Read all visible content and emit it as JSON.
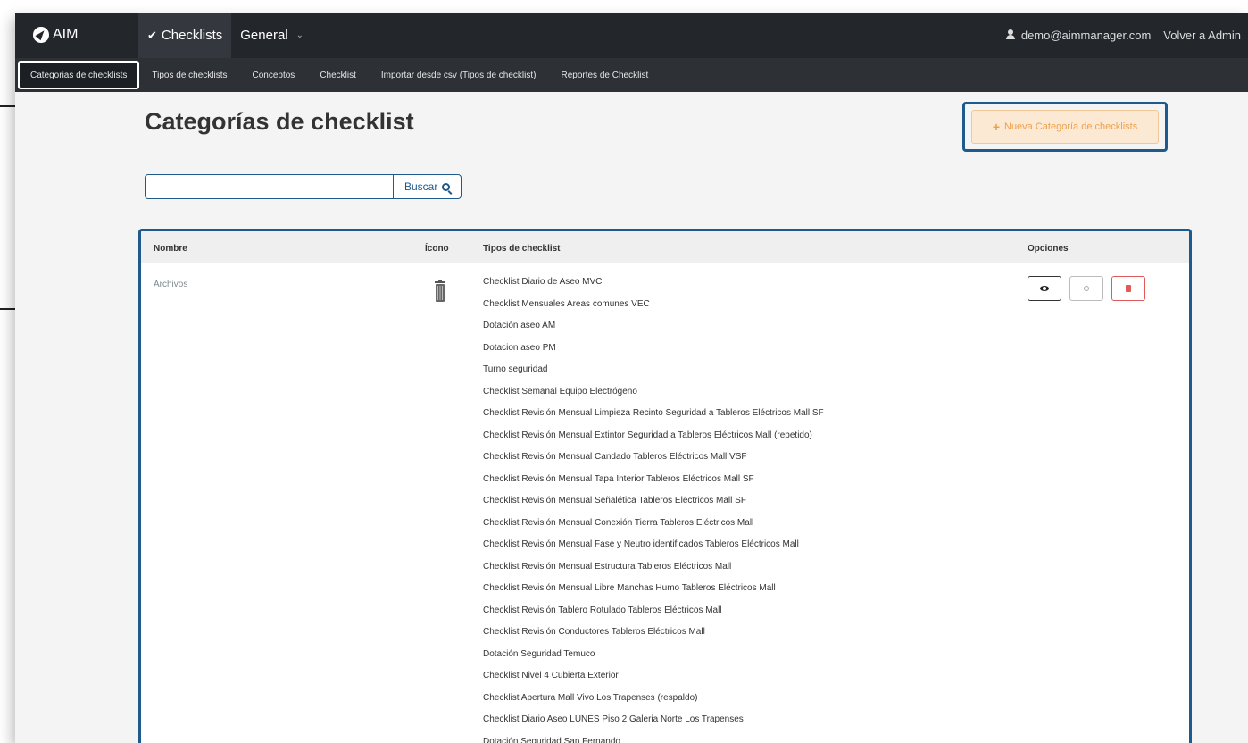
{
  "brand": {
    "name": "AIM"
  },
  "topnav": {
    "tabs": [
      {
        "label": "Checklists",
        "active": true
      },
      {
        "label": "General",
        "dropdown": true
      }
    ],
    "user_email": "demo@aimmanager.com",
    "back_admin": "Volver a Admin"
  },
  "subnav": {
    "items": [
      {
        "label": "Categorias de checklists",
        "active": true
      },
      {
        "label": "Tipos de checklists"
      },
      {
        "label": "Conceptos"
      },
      {
        "label": "Checklist"
      },
      {
        "label": "Importar desde csv (Tipos de checklist)"
      },
      {
        "label": "Reportes de Checklist"
      }
    ]
  },
  "page": {
    "title": "Categorías de checklist",
    "new_button": "Nueva Categoría de checklists"
  },
  "search": {
    "value": "",
    "button_label": "Buscar"
  },
  "table": {
    "headers": {
      "name": "Nombre",
      "icon": "Ícono",
      "types": "Tipos de checklist",
      "options": "Opciones"
    },
    "row": {
      "name": "Archivos",
      "icon": "trash-icon",
      "types": [
        "Checklist Diario de Aseo MVC",
        "Checklist Mensuales Areas comunes VEC",
        "Dotación aseo AM",
        "Dotacion aseo PM",
        "Turno seguridad",
        "Checklist Semanal Equipo Electrógeno",
        "Checklist Revisión Mensual Limpieza Recinto Seguridad a Tableros Eléctricos Mall SF",
        "Checklist Revisión Mensual Extintor Seguridad a Tableros Eléctricos Mall (repetido)",
        "Checklist Revisión Mensual Candado Tableros Eléctricos Mall VSF",
        "Checklist Revisión Mensual Tapa Interior Tableros Eléctricos Mall SF",
        "Checklist Revisión Mensual Señalética Tableros Eléctricos Mall SF",
        "Checklist Revisión Mensual Conexión Tierra Tableros Eléctricos Mall",
        "Checklist Revisión Mensual Fase y Neutro identificados Tableros Eléctricos Mall",
        "Checklist Revisión Mensual Estructura Tableros Eléctricos Mall",
        "Checklist Revisión Mensual Libre Manchas Humo Tableros Eléctricos Mall",
        "Checklist Revisión Tablero Rotulado Tableros Eléctricos Mall",
        "Checklist Revisión Conductores Tableros Eléctricos Mall",
        "Dotación Seguridad Temuco",
        "Checklist Nivel 4 Cubierta Exterior",
        "Checklist Apertura Mall Vivo Los Trapenses (respaldo)",
        "Checklist Diario Aseo LUNES Piso 2 Galeria Norte Los Trapenses",
        "Dotación Seguridad San Fernando"
      ],
      "options": [
        "view-icon",
        "edit-icon",
        "delete-icon"
      ]
    }
  },
  "colors": {
    "accent": "#1e5b8c",
    "navbar": "#23262b",
    "warning": "#f0a04b",
    "danger": "#e05a5a"
  }
}
